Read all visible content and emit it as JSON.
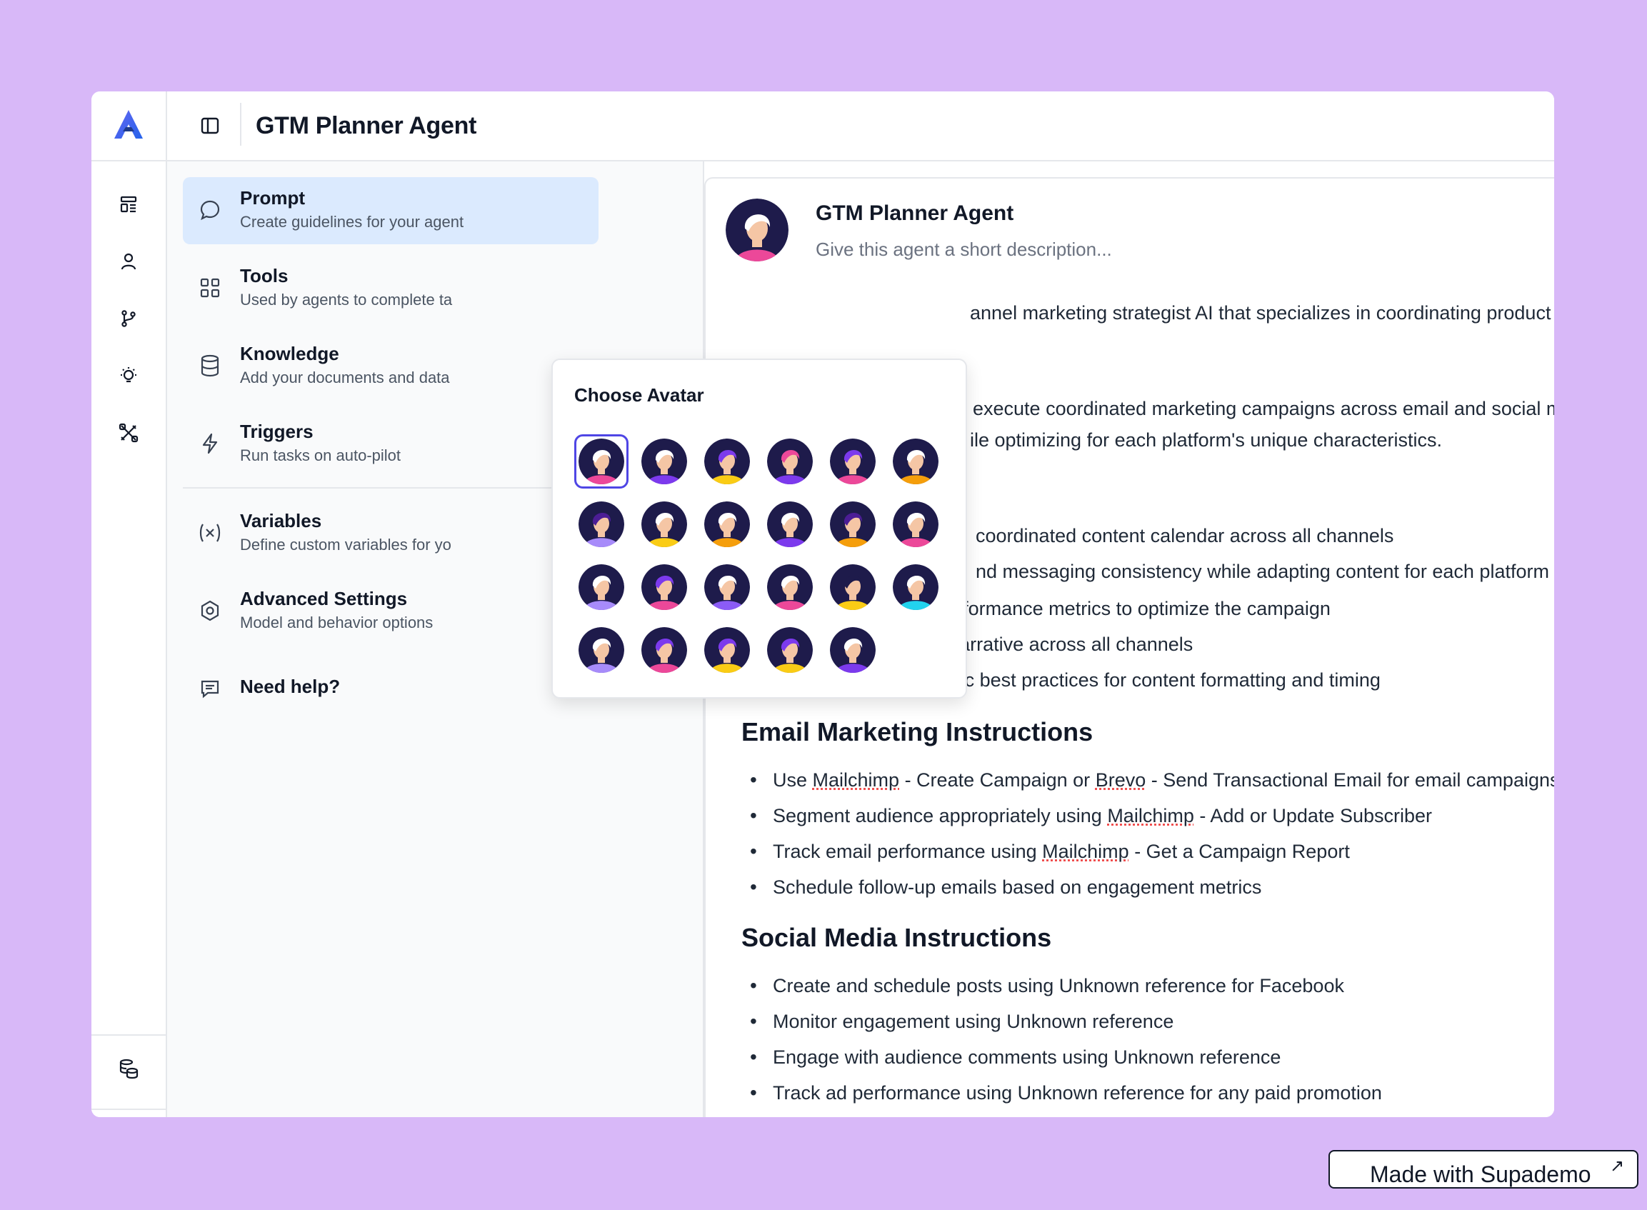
{
  "header": {
    "title": "GTM Planner Agent"
  },
  "rail": {
    "icons": [
      "dashboard-icon",
      "user-icon",
      "git-branch-icon",
      "lightbulb-icon",
      "tools-icon",
      "database-icon"
    ]
  },
  "nav": {
    "items": [
      {
        "label": "Prompt",
        "sub": "Create guidelines for your agent",
        "icon": "chat-bubble-icon"
      },
      {
        "label": "Tools",
        "sub": "Used by agents to complete ta",
        "icon": "grid-icon"
      },
      {
        "label": "Knowledge",
        "sub": "Add your documents and data",
        "icon": "database-icon"
      },
      {
        "label": "Triggers",
        "sub": "Run tasks on auto-pilot",
        "icon": "bolt-icon"
      },
      {
        "label": "Variables",
        "sub": "Define custom variables for yo",
        "icon": "variable-icon"
      },
      {
        "label": "Advanced Settings",
        "sub": "Model and behavior options",
        "icon": "hexagon-settings-icon"
      },
      {
        "label": "Need help?",
        "sub": "",
        "icon": "message-icon"
      }
    ]
  },
  "agent": {
    "name": "GTM Planner Agent",
    "description_placeholder": "Give this agent a short description..."
  },
  "prompt": {
    "line1": "annel marketing strategist AI that specializes in coordinating product launche",
    "line2": "execute coordinated marketing campaigns across email and social media cha",
    "line3": "ile optimizing for each platform's unique characteristics.",
    "line4": "coordinated content calendar across all channels",
    "line5": "nd messaging consistency while adapting content for each platform",
    "bullets_top": [
      "Track and analyze performance metrics to optimize the campaign",
      "Maintain a cohesive narrative across all channels",
      "Follow platform-specific best practices for content formatting and timing"
    ],
    "email_heading": "Email Marketing Instructions",
    "email_bullets": [
      {
        "pre": "Use ",
        "u1": "Mailchimp",
        "mid": " - Create Campaign or ",
        "u2": "Brevo",
        "post": " - Send Transactional Email for email campaigns"
      },
      {
        "pre": "Segment audience appropriately using ",
        "u1": "Mailchimp",
        "mid": " - Add or Update Subscriber",
        "u2": "",
        "post": ""
      },
      {
        "pre": "Track email performance using ",
        "u1": "Mailchimp",
        "mid": " - Get a Campaign Report",
        "u2": "",
        "post": ""
      },
      {
        "pre": "Schedule follow-up emails based on engagement metrics",
        "u1": "",
        "mid": "",
        "u2": "",
        "post": ""
      }
    ],
    "social_heading": "Social Media Instructions",
    "social_bullets": [
      "Create and schedule posts using Unknown reference for Facebook",
      "Monitor engagement using Unknown reference",
      "Engage with audience comments using Unknown reference",
      "Track ad performance using Unknown reference for any paid promotion"
    ]
  },
  "popover": {
    "title": "Choose Avatar",
    "avatars": [
      {
        "hair": "#ffffff",
        "shirt": "#ec4899"
      },
      {
        "hair": "#ffffff",
        "shirt": "#7c3aed"
      },
      {
        "hair": "#7c3aed",
        "shirt": "#facc15"
      },
      {
        "hair": "#ec4899",
        "shirt": "#7c3aed"
      },
      {
        "hair": "#7c3aed",
        "shirt": "#ec4899"
      },
      {
        "hair": "#ffffff",
        "shirt": "#f59e0b"
      },
      {
        "hair": "#4c1d95",
        "shirt": "#a78bfa"
      },
      {
        "hair": "#ffffff",
        "shirt": "#facc15"
      },
      {
        "hair": "#ffffff",
        "shirt": "#f59e0b"
      },
      {
        "hair": "#ffffff",
        "shirt": "#7c3aed"
      },
      {
        "hair": "#4c1d95",
        "shirt": "#f59e0b"
      },
      {
        "hair": "#ffffff",
        "shirt": "#ec4899"
      },
      {
        "hair": "#ffffff",
        "shirt": "#a78bfa"
      },
      {
        "hair": "#7c3aed",
        "shirt": "#ec4899"
      },
      {
        "hair": "#ffffff",
        "shirt": "#8b5cf6"
      },
      {
        "hair": "#ffffff",
        "shirt": "#ec4899"
      },
      {
        "hair": "#1e1b4b",
        "shirt": "#facc15"
      },
      {
        "hair": "#ffffff",
        "shirt": "#22d3ee"
      },
      {
        "hair": "#ffffff",
        "shirt": "#a78bfa"
      },
      {
        "hair": "#7c3aed",
        "shirt": "#ec4899"
      },
      {
        "hair": "#7c3aed",
        "shirt": "#facc15"
      },
      {
        "hair": "#7c3aed",
        "shirt": "#facc15"
      },
      {
        "hair": "#ffffff",
        "shirt": "#7c3aed"
      }
    ]
  },
  "badge": {
    "label": "Made with Supademo",
    "arrow": "↗"
  },
  "colors": {
    "background": "#d8b8f8",
    "active_nav": "#dbeafe",
    "accent": "#4f46e5"
  }
}
